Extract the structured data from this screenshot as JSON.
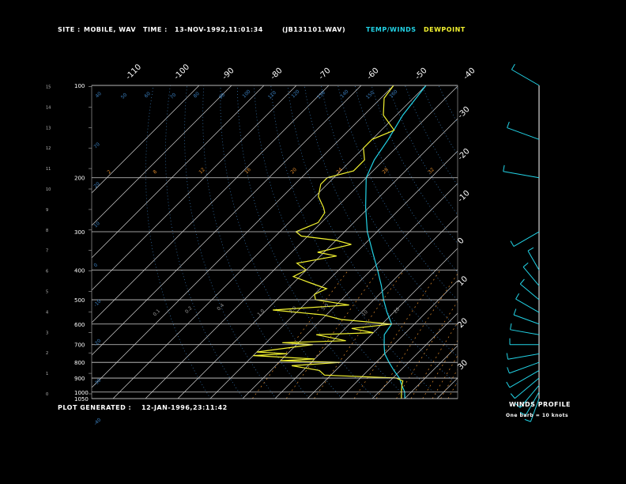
{
  "header": {
    "site_label": "SITE :",
    "site_value": "MOBILE, WAV",
    "time_label": "TIME :",
    "time_value": "13-NOV-1992,11:01:34",
    "file": "(JB131101.WAV)",
    "legend_temp": "TEMP/WINDS",
    "legend_dew": "DEWPOINT"
  },
  "footer": {
    "generated_label": "PLOT GENERATED :",
    "generated_value": "12-JAN-1996,23:11:42",
    "winds_title": "WINDS PROFILE",
    "winds_note": "One barb = 10 knots"
  },
  "colors": {
    "background": "#000000",
    "temperature": "#22d3e6",
    "dewpoint": "#f2f230",
    "grid": "#ffffff",
    "mixing_ratio": "#e08a2a",
    "dry_adiabat": "#3a7fbf",
    "wind": "#22d3e6"
  },
  "chart_data": {
    "type": "skew-t",
    "pressure_levels": [
      100,
      200,
      300,
      400,
      500,
      600,
      700,
      800,
      900,
      1000,
      1050
    ],
    "height_km_ticks": [
      "0",
      "1",
      "2",
      "3",
      "4",
      "5",
      "6",
      "7",
      "8",
      "9",
      "10",
      "11",
      "12",
      "13",
      "14",
      "15"
    ],
    "isotherm_labels": [
      "-110",
      "-100",
      "-90",
      "-80",
      "-70",
      "-60",
      "-50",
      "-40",
      "-30",
      "-20",
      "-10",
      "0",
      "10",
      "20",
      "30"
    ],
    "mixing_ratio_labels": [
      "2",
      "8",
      "12",
      "16",
      "20",
      "24",
      "28",
      "32"
    ],
    "adiabat_labels_top": [
      "40",
      "50",
      "60",
      "70",
      "80",
      "90",
      "100",
      "110",
      "120",
      "130",
      "140",
      "150",
      "160"
    ],
    "adiabat_labels_side": [
      "70",
      "20",
      "10",
      "0",
      "-10",
      "-20",
      "-30",
      "-40"
    ],
    "low_mixing_ratio_labels": [
      "0.1",
      "0.2",
      "0.4",
      "1.0",
      "2.0",
      "5.0",
      "10",
      "20"
    ],
    "temperature": {
      "p": [
        1050,
        1000,
        950,
        900,
        850,
        800,
        750,
        700,
        650,
        600,
        550,
        500,
        450,
        400,
        350,
        300,
        250,
        200,
        175,
        150,
        125,
        100
      ],
      "t": [
        20,
        18,
        15,
        12,
        8,
        4,
        0,
        -3,
        -6,
        -7,
        -12,
        -17,
        -22,
        -28,
        -35,
        -43,
        -51,
        -60,
        -63,
        -65,
        -68,
        -70
      ]
    },
    "dewpoint": {
      "p": [
        1050,
        1000,
        950,
        920,
        900,
        880,
        850,
        820,
        800,
        790,
        780,
        760,
        750,
        740,
        700,
        690,
        680,
        650,
        640,
        620,
        600,
        580,
        560,
        540,
        520,
        500,
        480,
        460,
        440,
        420,
        400,
        380,
        360,
        350,
        330,
        320,
        310,
        300,
        280,
        260,
        250,
        230,
        210,
        200,
        190,
        175,
        160,
        150,
        140,
        125,
        110,
        100
      ],
      "td": [
        19,
        17,
        15,
        14,
        11,
        -12,
        -15,
        -25,
        -11,
        -30,
        -20,
        -40,
        -30,
        -40,
        -25,
        -35,
        -16,
        -27,
        -10,
        -18,
        -7,
        -24,
        -31,
        -48,
        -26,
        -38,
        -40,
        -38,
        -45,
        -52,
        -50,
        -55,
        -45,
        -52,
        -44,
        -50,
        -62,
        -65,
        -61,
        -62,
        -64,
        -69,
        -72,
        -72,
        -66,
        -66,
        -70,
        -70,
        -66,
        -74,
        -79,
        -80
      ]
    },
    "winds": [
      {
        "p": 1050,
        "spd": 15,
        "dir": 200
      },
      {
        "p": 1000,
        "spd": 20,
        "dir": 210
      },
      {
        "p": 950,
        "spd": 25,
        "dir": 220
      },
      {
        "p": 900,
        "spd": 30,
        "dir": 230
      },
      {
        "p": 850,
        "spd": 35,
        "dir": 240
      },
      {
        "p": 800,
        "spd": 30,
        "dir": 250
      },
      {
        "p": 750,
        "spd": 30,
        "dir": 260
      },
      {
        "p": 700,
        "spd": 25,
        "dir": 270
      },
      {
        "p": 650,
        "spd": 25,
        "dir": 280
      },
      {
        "p": 600,
        "spd": 20,
        "dir": 290
      },
      {
        "p": 550,
        "spd": 20,
        "dir": 300
      },
      {
        "p": 500,
        "spd": 15,
        "dir": 310
      },
      {
        "p": 450,
        "spd": 15,
        "dir": 320
      },
      {
        "p": 400,
        "spd": 10,
        "dir": 330
      },
      {
        "p": 300,
        "spd": 25,
        "dir": 240
      },
      {
        "p": 200,
        "spd": 40,
        "dir": 280
      },
      {
        "p": 150,
        "spd": 35,
        "dir": 290
      },
      {
        "p": 100,
        "spd": 30,
        "dir": 300
      }
    ]
  }
}
